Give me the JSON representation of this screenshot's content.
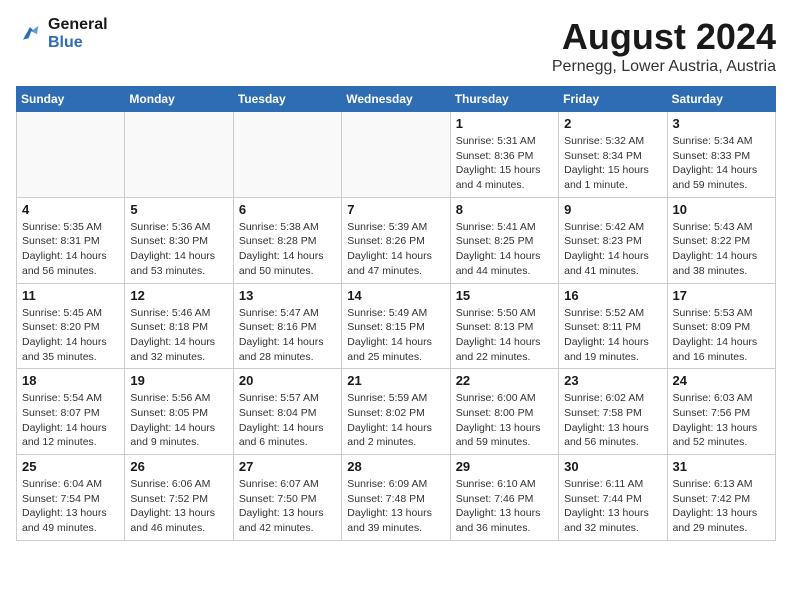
{
  "logo": {
    "line1": "General",
    "line2": "Blue"
  },
  "title": "August 2024",
  "subtitle": "Pernegg, Lower Austria, Austria",
  "weekdays": [
    "Sunday",
    "Monday",
    "Tuesday",
    "Wednesday",
    "Thursday",
    "Friday",
    "Saturday"
  ],
  "weeks": [
    [
      {
        "day": "",
        "info": ""
      },
      {
        "day": "",
        "info": ""
      },
      {
        "day": "",
        "info": ""
      },
      {
        "day": "",
        "info": ""
      },
      {
        "day": "1",
        "info": "Sunrise: 5:31 AM\nSunset: 8:36 PM\nDaylight: 15 hours\nand 4 minutes."
      },
      {
        "day": "2",
        "info": "Sunrise: 5:32 AM\nSunset: 8:34 PM\nDaylight: 15 hours\nand 1 minute."
      },
      {
        "day": "3",
        "info": "Sunrise: 5:34 AM\nSunset: 8:33 PM\nDaylight: 14 hours\nand 59 minutes."
      }
    ],
    [
      {
        "day": "4",
        "info": "Sunrise: 5:35 AM\nSunset: 8:31 PM\nDaylight: 14 hours\nand 56 minutes."
      },
      {
        "day": "5",
        "info": "Sunrise: 5:36 AM\nSunset: 8:30 PM\nDaylight: 14 hours\nand 53 minutes."
      },
      {
        "day": "6",
        "info": "Sunrise: 5:38 AM\nSunset: 8:28 PM\nDaylight: 14 hours\nand 50 minutes."
      },
      {
        "day": "7",
        "info": "Sunrise: 5:39 AM\nSunset: 8:26 PM\nDaylight: 14 hours\nand 47 minutes."
      },
      {
        "day": "8",
        "info": "Sunrise: 5:41 AM\nSunset: 8:25 PM\nDaylight: 14 hours\nand 44 minutes."
      },
      {
        "day": "9",
        "info": "Sunrise: 5:42 AM\nSunset: 8:23 PM\nDaylight: 14 hours\nand 41 minutes."
      },
      {
        "day": "10",
        "info": "Sunrise: 5:43 AM\nSunset: 8:22 PM\nDaylight: 14 hours\nand 38 minutes."
      }
    ],
    [
      {
        "day": "11",
        "info": "Sunrise: 5:45 AM\nSunset: 8:20 PM\nDaylight: 14 hours\nand 35 minutes."
      },
      {
        "day": "12",
        "info": "Sunrise: 5:46 AM\nSunset: 8:18 PM\nDaylight: 14 hours\nand 32 minutes."
      },
      {
        "day": "13",
        "info": "Sunrise: 5:47 AM\nSunset: 8:16 PM\nDaylight: 14 hours\nand 28 minutes."
      },
      {
        "day": "14",
        "info": "Sunrise: 5:49 AM\nSunset: 8:15 PM\nDaylight: 14 hours\nand 25 minutes."
      },
      {
        "day": "15",
        "info": "Sunrise: 5:50 AM\nSunset: 8:13 PM\nDaylight: 14 hours\nand 22 minutes."
      },
      {
        "day": "16",
        "info": "Sunrise: 5:52 AM\nSunset: 8:11 PM\nDaylight: 14 hours\nand 19 minutes."
      },
      {
        "day": "17",
        "info": "Sunrise: 5:53 AM\nSunset: 8:09 PM\nDaylight: 14 hours\nand 16 minutes."
      }
    ],
    [
      {
        "day": "18",
        "info": "Sunrise: 5:54 AM\nSunset: 8:07 PM\nDaylight: 14 hours\nand 12 minutes."
      },
      {
        "day": "19",
        "info": "Sunrise: 5:56 AM\nSunset: 8:05 PM\nDaylight: 14 hours\nand 9 minutes."
      },
      {
        "day": "20",
        "info": "Sunrise: 5:57 AM\nSunset: 8:04 PM\nDaylight: 14 hours\nand 6 minutes."
      },
      {
        "day": "21",
        "info": "Sunrise: 5:59 AM\nSunset: 8:02 PM\nDaylight: 14 hours\nand 2 minutes."
      },
      {
        "day": "22",
        "info": "Sunrise: 6:00 AM\nSunset: 8:00 PM\nDaylight: 13 hours\nand 59 minutes."
      },
      {
        "day": "23",
        "info": "Sunrise: 6:02 AM\nSunset: 7:58 PM\nDaylight: 13 hours\nand 56 minutes."
      },
      {
        "day": "24",
        "info": "Sunrise: 6:03 AM\nSunset: 7:56 PM\nDaylight: 13 hours\nand 52 minutes."
      }
    ],
    [
      {
        "day": "25",
        "info": "Sunrise: 6:04 AM\nSunset: 7:54 PM\nDaylight: 13 hours\nand 49 minutes."
      },
      {
        "day": "26",
        "info": "Sunrise: 6:06 AM\nSunset: 7:52 PM\nDaylight: 13 hours\nand 46 minutes."
      },
      {
        "day": "27",
        "info": "Sunrise: 6:07 AM\nSunset: 7:50 PM\nDaylight: 13 hours\nand 42 minutes."
      },
      {
        "day": "28",
        "info": "Sunrise: 6:09 AM\nSunset: 7:48 PM\nDaylight: 13 hours\nand 39 minutes."
      },
      {
        "day": "29",
        "info": "Sunrise: 6:10 AM\nSunset: 7:46 PM\nDaylight: 13 hours\nand 36 minutes."
      },
      {
        "day": "30",
        "info": "Sunrise: 6:11 AM\nSunset: 7:44 PM\nDaylight: 13 hours\nand 32 minutes."
      },
      {
        "day": "31",
        "info": "Sunrise: 6:13 AM\nSunset: 7:42 PM\nDaylight: 13 hours\nand 29 minutes."
      }
    ]
  ]
}
